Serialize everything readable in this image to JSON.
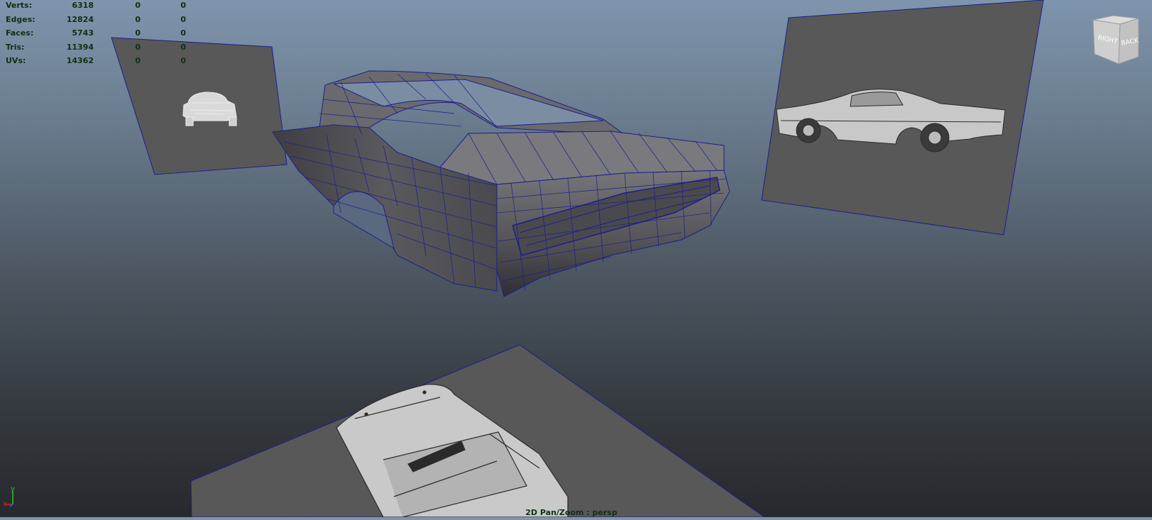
{
  "hud": {
    "rows": [
      {
        "label": "Verts:",
        "v1": "6318",
        "v2": "0",
        "v3": "0"
      },
      {
        "label": "Edges:",
        "v1": "12824",
        "v2": "0",
        "v3": "0"
      },
      {
        "label": "Faces:",
        "v1": "5743",
        "v2": "0",
        "v3": "0"
      },
      {
        "label": "Tris:",
        "v1": "11394",
        "v2": "0",
        "v3": "0"
      },
      {
        "label": "UVs:",
        "v1": "14362",
        "v2": "0",
        "v3": "0"
      }
    ]
  },
  "viewcube": {
    "right_label": "RIGHT",
    "back_label": "BACK"
  },
  "axis": {
    "x_label": "x",
    "y_label": "y"
  },
  "viewport": {
    "label": "2D Pan/Zoom : persp"
  },
  "colors": {
    "hud_text": "#0f2f12",
    "wire": "#1b1f8a",
    "mesh_light": "#6e6e72",
    "mesh_dark": "#3e3e42",
    "plane": "#595959"
  }
}
